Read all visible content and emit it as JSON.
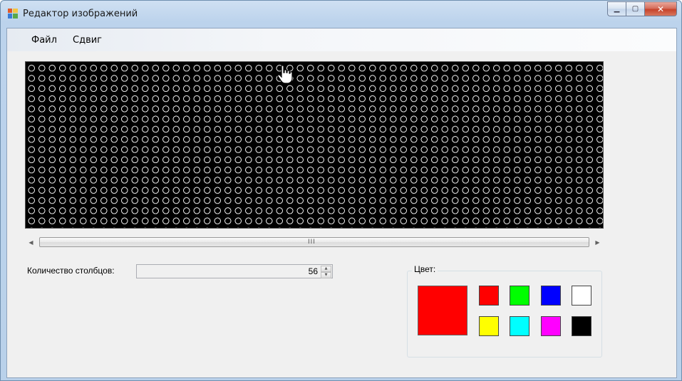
{
  "window": {
    "title": "Редактор изображений"
  },
  "menu": {
    "file": "Файл",
    "shift": "Сдвиг"
  },
  "scrollbar": {
    "grip": "III"
  },
  "columns": {
    "label": "Количество столбцов:",
    "value": "56"
  },
  "color_group": {
    "title": "Цвет:",
    "current_color": "#ff0000",
    "swatches": [
      "#ff0000",
      "#00ff00",
      "#0000ff",
      "#ffffff",
      "#ffff00",
      "#00ffff",
      "#ff00ff",
      "#000000"
    ]
  },
  "canvas": {
    "background": "#000000",
    "led_color": "#e6e6e6"
  }
}
